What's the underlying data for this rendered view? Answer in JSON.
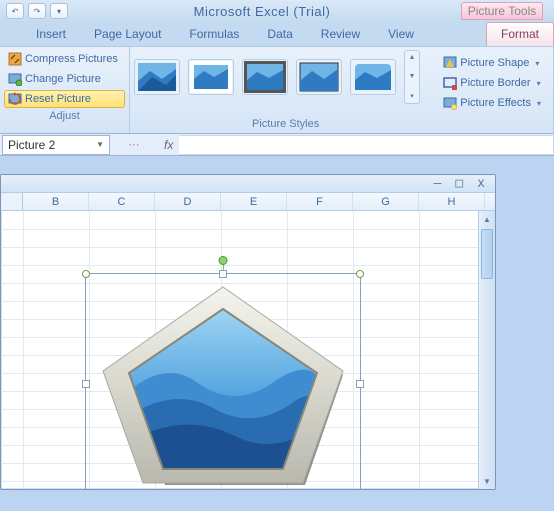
{
  "titlebar": {
    "app_title": "Microsoft Excel (Trial)",
    "context_tab": "Picture Tools"
  },
  "tabs": {
    "insert": "Insert",
    "page_layout": "Page Layout",
    "formulas": "Formulas",
    "data": "Data",
    "review": "Review",
    "view": "View",
    "format": "Format"
  },
  "ribbon": {
    "adjust": {
      "compress": "Compress Pictures",
      "change": "Change Picture",
      "reset": "Reset Picture",
      "group_label": "Adjust"
    },
    "styles": {
      "group_label": "Picture Styles",
      "shape": "Picture Shape",
      "border": "Picture Border",
      "effects": "Picture Effects"
    }
  },
  "namebox": {
    "value": "Picture 2"
  },
  "formula": {
    "fx": "fx"
  },
  "columns": [
    "B",
    "C",
    "D",
    "E",
    "F",
    "G",
    "H"
  ],
  "window_ctrls": {
    "min": "–",
    "max": "□",
    "close": "x"
  }
}
